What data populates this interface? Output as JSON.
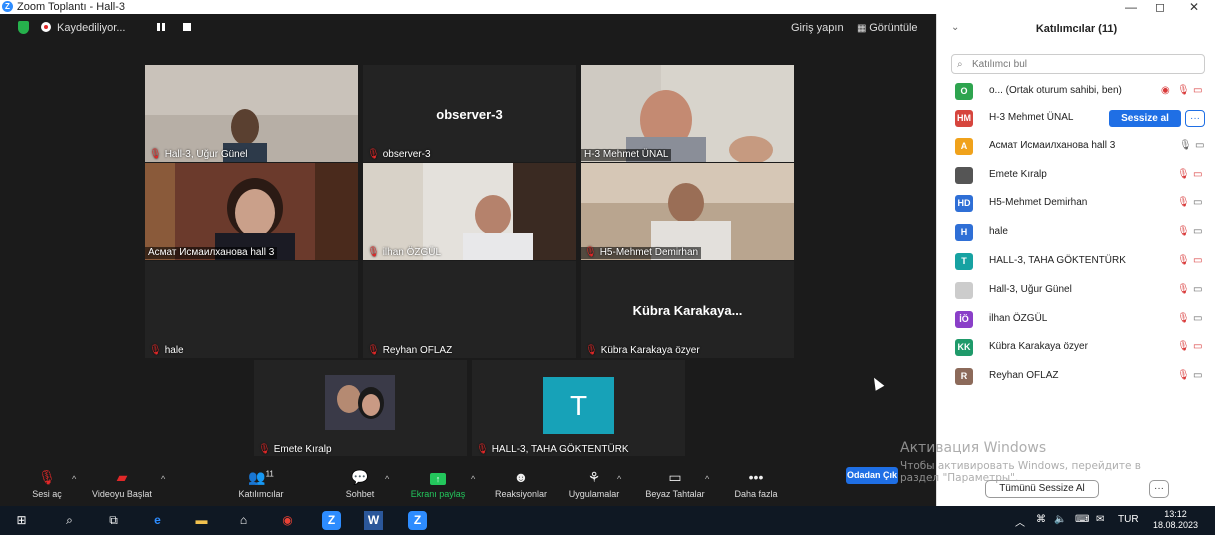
{
  "window": {
    "title": "Zoom Toplantı - Hall-3",
    "minimize": "—",
    "maximize": "◻",
    "close": "✕"
  },
  "topbar": {
    "recording_label": "Kaydediliyor...",
    "signin": "Giriş yapın",
    "view": "Görüntüle"
  },
  "tiles": [
    {
      "name": "Hall-3, Uğur Günel",
      "big_name": "",
      "muted": true
    },
    {
      "name": "observer-3",
      "big_name": "observer-3",
      "muted": true
    },
    {
      "name": "H-3 Mehmet ÜNAL",
      "big_name": "",
      "muted": false
    },
    {
      "name": "Асмат Исмаилханова hall 3",
      "big_name": "",
      "muted": false,
      "active": true
    },
    {
      "name": "ilhan ÖZGÜL",
      "big_name": "",
      "muted": true
    },
    {
      "name": "H5-Mehmet Demirhan",
      "big_name": "",
      "muted": true
    },
    {
      "name": "hale",
      "big_name": "",
      "muted": true
    },
    {
      "name": "Reyhan OFLAZ",
      "big_name": "",
      "muted": true
    },
    {
      "name": "Kübra Karakaya özyer",
      "big_name": "Kübra Karakaya...",
      "muted": true
    },
    {
      "name": "Emete Kıralp",
      "big_name": "",
      "muted": true
    },
    {
      "name": "HALL-3, TAHA GÖKTENTÜRK",
      "big_name": "",
      "avatar_letter": "T",
      "muted": true
    }
  ],
  "toolbar": {
    "unmute": "Sesi aç",
    "start_video": "Videoyu Başlat",
    "participants": "Katılımcılar",
    "participants_count": "11",
    "chat": "Sohbet",
    "share": "Ekranı paylaş",
    "reactions": "Reaksiyonlar",
    "apps": "Uygulamalar",
    "whiteboards": "Beyaz Tahtalar",
    "more": "Daha fazla",
    "leave": "Odadan Çık"
  },
  "panel": {
    "title": "Katılımcılar (11)",
    "search_placeholder": "Katılımcı bul",
    "mute_all": "Tümünü Sessize Al",
    "more": "···",
    "ask_unmute": "Sessize al",
    "participants": [
      {
        "initials": "O",
        "name": "o... (Ortak oturum sahibi, ben)",
        "color": "#2ea44f",
        "mic": "muted",
        "cam": "off",
        "recording": true
      },
      {
        "initials": "HM",
        "name": "H-3 Mehmet ÜNAL",
        "color": "#d6453d",
        "mic": "on",
        "cam": "on",
        "hover": true
      },
      {
        "initials": "A",
        "name": "Асмат Исмаилханова hall 3",
        "color": "#f0a21b",
        "mic": "on",
        "cam": "on"
      },
      {
        "initials": "",
        "name": "Emete Kıralp",
        "color": "#555555",
        "mic": "muted",
        "cam": "off",
        "photo": true
      },
      {
        "initials": "HD",
        "name": "H5-Mehmet Demirhan",
        "color": "#2f6fd6",
        "mic": "muted",
        "cam": "on"
      },
      {
        "initials": "H",
        "name": "hale",
        "color": "#2f6fd6",
        "mic": "muted",
        "cam": "on"
      },
      {
        "initials": "T",
        "name": "HALL-3, TAHA GÖKTENTÜRK",
        "color": "#17a2a2",
        "mic": "muted",
        "cam": "off"
      },
      {
        "initials": "",
        "name": "Hall-3, Uğur Günel",
        "color": "#cccccc",
        "mic": "muted",
        "cam": "on",
        "photo": true
      },
      {
        "initials": "İÖ",
        "name": "ilhan ÖZGÜL",
        "color": "#8a3fc8",
        "mic": "muted",
        "cam": "on"
      },
      {
        "initials": "KK",
        "name": "Kübra Karakaya özyer",
        "color": "#1f9a6a",
        "mic": "muted",
        "cam": "off"
      },
      {
        "initials": "R",
        "name": "Reyhan OFLAZ",
        "color": "#8c6a5a",
        "mic": "muted",
        "cam": "on"
      }
    ]
  },
  "watermark": {
    "line1": "Активация Windows",
    "line2": "Чтобы активировать Windows, перейдите в",
    "line3": "раздел \"Параметры\"."
  },
  "taskbar": {
    "language": "TUR",
    "time": "13:12",
    "date": "18.08.2023"
  }
}
